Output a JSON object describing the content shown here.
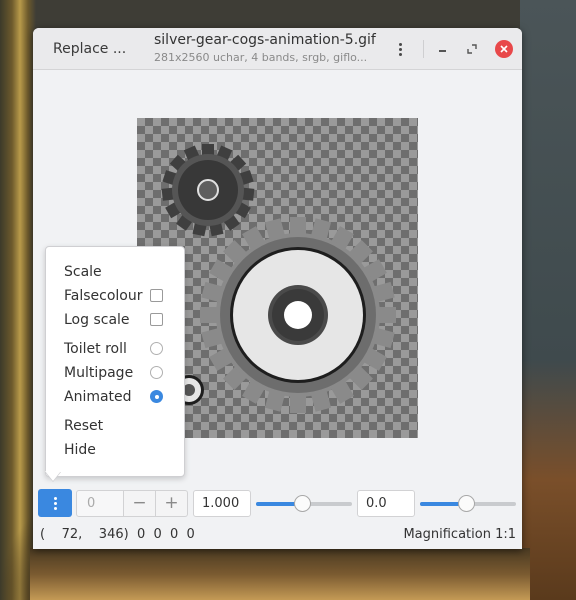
{
  "window": {
    "replace_label": "Replace ...",
    "title": "silver-gear-cogs-animation-5.gif",
    "subtitle": "281x2560 uchar, 4 bands, srgb, giflo..."
  },
  "icons": {
    "title_menu": "vertical-dots-icon",
    "minimize": "minimize-icon",
    "maximize": "maximize-icon",
    "close": "close-icon",
    "view_menu": "vertical-dots-icon"
  },
  "colors": {
    "accent": "#3a88e0",
    "close": "#e8484a"
  },
  "menu": {
    "scale": "Scale",
    "falsecolour": "Falsecolour",
    "falsecolour_checked": false,
    "log_scale": "Log scale",
    "log_scale_checked": false,
    "toilet_roll": "Toilet roll",
    "multipage": "Multipage",
    "animated": "Animated",
    "selected_mode": "Animated",
    "reset": "Reset",
    "hide": "Hide"
  },
  "toolbar": {
    "page_value": "0",
    "minus": "−",
    "plus": "+",
    "scale_value": "1.000",
    "scale_slider_fraction": 0.48,
    "offset_value": "0.0",
    "offset_slider_fraction": 0.48
  },
  "status": {
    "coords": "(    72,    346)  0  0  0  0",
    "magnification": "Magnification 1:1"
  }
}
